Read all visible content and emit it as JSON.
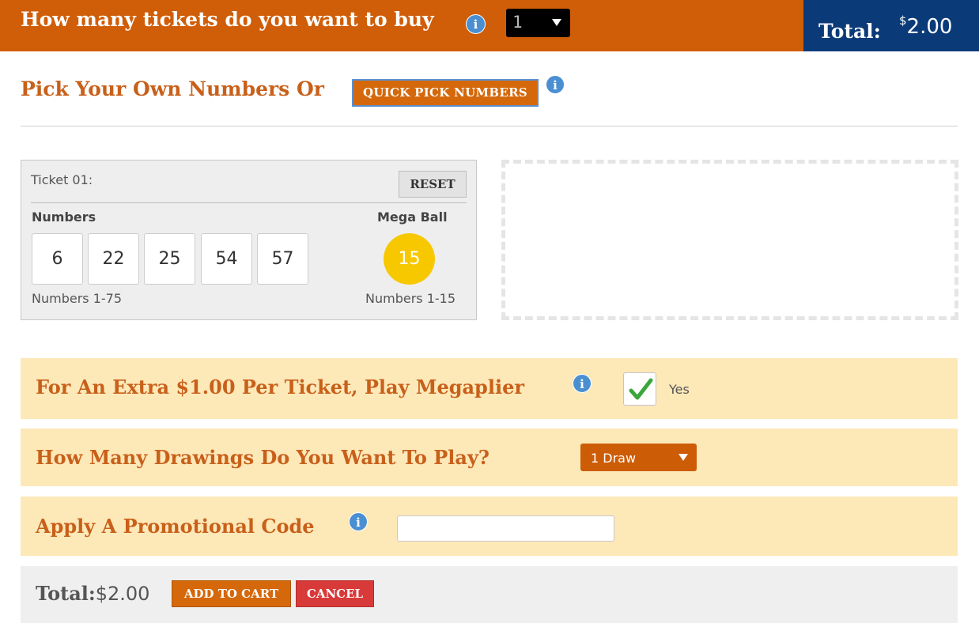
{
  "header": {
    "question": "How many tickets do you want to buy",
    "ticket_quantity": "1",
    "total_label": "Total:",
    "total_currency": "$",
    "total_amount": "2.00"
  },
  "pick": {
    "title": "Pick Your Own Numbers Or",
    "quick_pick_label": "QUICK PICK NUMBERS"
  },
  "ticket": {
    "label": "Ticket 01:",
    "reset_label": "RESET",
    "numbers_heading": "Numbers",
    "mega_heading": "Mega Ball",
    "numbers": [
      "6",
      "22",
      "25",
      "54",
      "57"
    ],
    "mega_ball": "15",
    "numbers_range": "Numbers 1-75",
    "mega_range": "Numbers 1-15",
    "mega_ball_color": "#f7c800"
  },
  "megaplier": {
    "title": "For An Extra $1.00 Per Ticket, Play Megaplier",
    "checked": true,
    "checkbox_label": "Yes"
  },
  "drawings": {
    "title": "How Many Drawings Do You Want To Play?",
    "selected": "1 Draw"
  },
  "promo": {
    "title": "Apply A Promotional Code",
    "value": ""
  },
  "footer": {
    "total_label": "Total:",
    "total_value": "$2.00",
    "add_to_cart_label": "ADD TO CART",
    "cancel_label": "CANCEL"
  },
  "colors": {
    "brand_orange": "#d05d07",
    "navy": "#0a3a78",
    "row_bg": "#fde8b8",
    "cancel_red": "#d83a3a"
  },
  "icons": {
    "info": "info-icon",
    "dropdown": "chevron-down-icon",
    "check": "checkmark-icon"
  }
}
